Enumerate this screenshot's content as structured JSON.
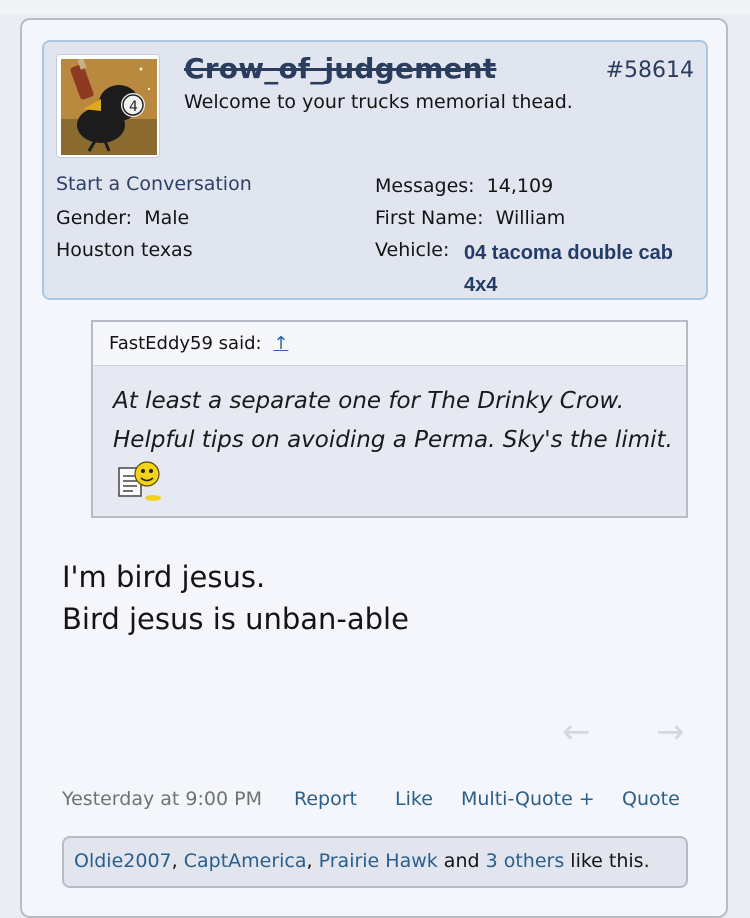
{
  "post": {
    "username": "Crow_of_judgement",
    "post_number": "#58614",
    "user_title": "Welcome to your trucks memorial thead.",
    "start_conversation": "Start a Conversation",
    "gender_label": "Gender:",
    "gender_value": "Male",
    "location": "Houston texas",
    "messages_label": "Messages:",
    "messages_value": "14,109",
    "first_name_label": "First Name:",
    "first_name_value": "William",
    "vehicle_label": "Vehicle:",
    "vehicle_value": "04 tacoma double cab 4x4"
  },
  "quote": {
    "author": "FastEddy59 said:",
    "arrow": "↑",
    "text": "At least a separate one for The Drinky Crow. Helpful tips on avoiding a Perma. Sky's the limit."
  },
  "message": {
    "line1": "I'm bird jesus.",
    "line2": "Bird jesus is unban-able"
  },
  "nav": {
    "prev_icon": "←",
    "next_icon": "→"
  },
  "meta": {
    "timestamp": "Yesterday at 9:00 PM",
    "report": "Report",
    "like": "Like",
    "multi_quote": "Multi-Quote +",
    "quote": "Quote"
  },
  "likes": {
    "user1": "Oldie2007",
    "sep1": ", ",
    "user2": "CaptAmerica",
    "sep2": ", ",
    "user3": "Prairie Hawk",
    "and": " and ",
    "others": "3 others",
    "suffix": " like this."
  },
  "colors": {
    "link": "#2a5e8c",
    "username": "#2a3d5c",
    "panel_bg": "#e1e5f0",
    "panel_border": "#a9c8e0"
  }
}
